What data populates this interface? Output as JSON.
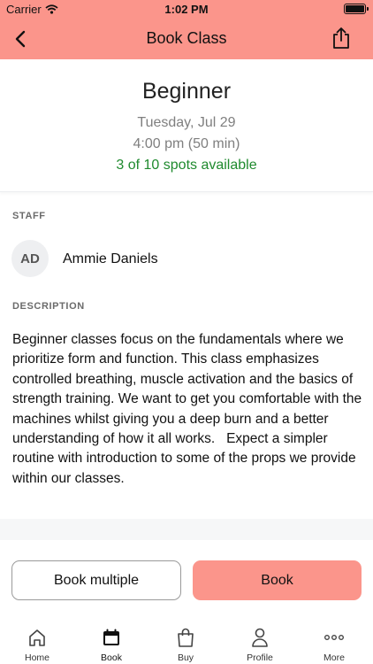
{
  "status_bar": {
    "carrier": "Carrier",
    "time": "1:02 PM"
  },
  "nav": {
    "title": "Book Class",
    "back_icon": "chevron-left-icon",
    "share_icon": "share-icon"
  },
  "class": {
    "name": "Beginner",
    "date": "Tuesday, Jul 29",
    "time": "4:00 pm (50 min)",
    "spots": "3 of 10 spots available"
  },
  "staff": {
    "label": "STAFF",
    "initials": "AD",
    "name": "Ammie Daniels"
  },
  "description": {
    "label": "DESCRIPTION",
    "text": "Beginner classes focus on the fundamentals where we prioritize form and function. This class emphasizes controlled breathing, muscle activation and the basics of strength training. We want to get you comfortable with the machines whilst giving you a deep burn and a better understanding of how it all works.   Expect a simpler routine with introduction to some of the props we provide within our classes."
  },
  "actions": {
    "book_multiple": "Book multiple",
    "book": "Book"
  },
  "tabs": [
    {
      "label": "Home",
      "icon": "home-icon"
    },
    {
      "label": "Book",
      "icon": "calendar-icon",
      "active": true
    },
    {
      "label": "Buy",
      "icon": "shopping-bag-icon"
    },
    {
      "label": "Profile",
      "icon": "person-icon"
    },
    {
      "label": "More",
      "icon": "more-dots-icon"
    }
  ],
  "colors": {
    "accent": "#fb958b",
    "spots_green": "#1f8a2e",
    "muted_text": "#7f7f7f"
  }
}
